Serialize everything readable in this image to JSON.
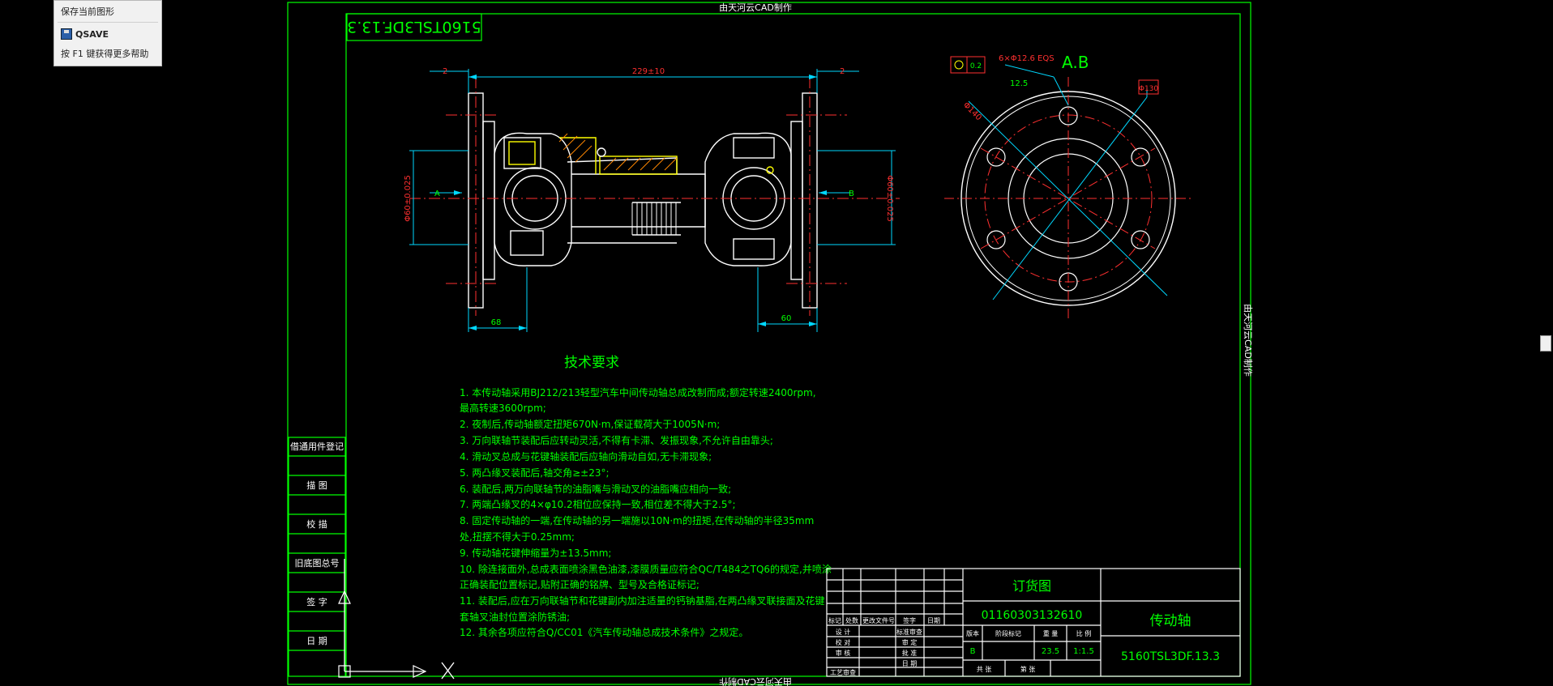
{
  "tooltip": {
    "title": "保存当前图形",
    "command": "QSAVE",
    "help": "按 F1 键获得更多帮助",
    "icon": "save-disk-icon"
  },
  "drawing": {
    "watermark": "由天河云CAD制作",
    "code_box": "5160TSL3DF.13.3",
    "dim_top": "229±10",
    "dim_left_small": "2",
    "dim_right_small": "2",
    "dim_bottom_left": "68",
    "dim_bottom_right": "60",
    "dim_left_dia": "Φ60±0.025",
    "dim_right_dia": "Φ60±0.025",
    "section_a": "A",
    "section_b": "B",
    "view_label": "A.B",
    "tolerance_value": "0.2",
    "holes_spec": "6×Φ12.6 EQS",
    "depth_spec": "12.5",
    "dia_left": "Φ140",
    "dia_right": "Φ130",
    "tech_title": "技术要求",
    "tech_lines": [
      "1. 本传动轴采用BJ212/213轻型汽车中间传动轴总成改制而成;额定转速2400rpm,",
      "    最高转速3600rpm;",
      "2. 夜制后,传动轴额定扭矩670N·m,保证载荷大于1005N·m;",
      "3. 万向联轴节装配后应转动灵活,不得有卡滞、发振现象,不允许自由靠头;",
      "4. 滑动叉总成与花键轴装配后应轴向滑动自如,无卡滞现象;",
      "5. 两凸缘叉装配后,轴交角≥±23°;",
      "6. 装配后,两万向联轴节的油脂嘴与滑动叉的油脂嘴应相向一致;",
      "7. 两端凸缘叉的4×φ10.2相位应保持一致,相位差不得大于2.5°;",
      "8. 固定传动轴的一端,在传动轴的另一端施以10N·m的扭矩,在传动轴的半径35mm",
      "    处,扭摆不得大于0.25mm;",
      "9. 传动轴花键伸缩量为±13.5mm;",
      "10. 除连接面外,总成表面喷涂黑色油漆,漆膜质量应符合QC/T484之TQ6的规定,并喷涂",
      "    正确装配位置标记,贴附正确的铭牌、型号及合格证标记;",
      "11. 装配后,应在万向联轴节和花键副内加注适量的钙钠基脂,在两凸缘叉联接面及花键",
      "    套轴叉油封位置涂防锈油;",
      "12. 其余各项应符合Q/CC01《汽车传动轴总成技术条件》之规定。"
    ],
    "left_boxes": [
      "借通用件登记",
      "描 图",
      "校 描",
      "旧底图总号",
      "签 字",
      "日 期"
    ],
    "title_block": {
      "drawing_type": "订货图",
      "part_number": "01160303132610",
      "part_name": "传动轴",
      "drawing_code": "5160TSL3DF.13.3",
      "version_label": "版本",
      "version_value": "B",
      "weight_label": "重 量",
      "weight_value": "23.5",
      "scale_label": "比 例",
      "scale_value": "1:1.5",
      "stage_label": "阶段标记",
      "sheet_total": "共 张",
      "sheet_no": "第 张",
      "row_labels": [
        "标记",
        "处数",
        "更改文件号",
        "签字",
        "日期"
      ],
      "role_labels": [
        "设 计",
        "校 对",
        "审 核",
        "工艺审查"
      ],
      "role_labels_right": [
        "标准审查",
        "审 定",
        "批 准",
        "日 期"
      ]
    }
  }
}
